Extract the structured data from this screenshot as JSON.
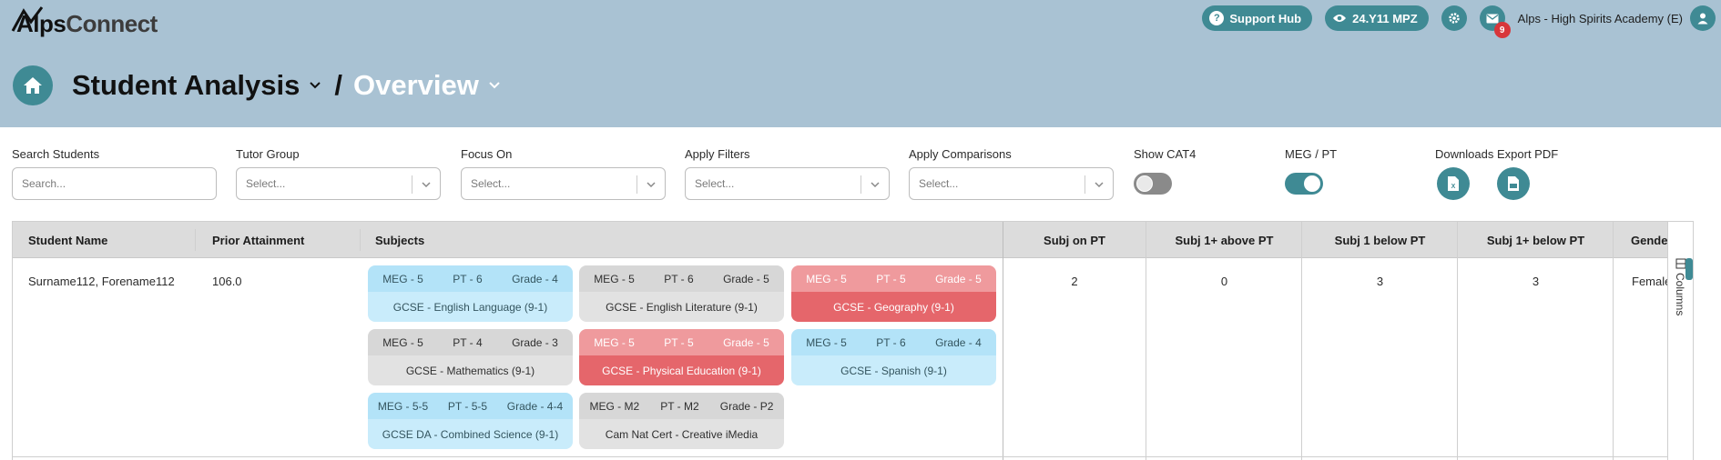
{
  "logo": {
    "alps": "Alps",
    "connect": "Connect"
  },
  "topbar": {
    "support_hub": "Support Hub",
    "data_pill": "24.Y11 MPZ",
    "notification_count": "9",
    "account_name": "Alps - High Spirits Academy (E)"
  },
  "page": {
    "title": "Student Analysis",
    "separator": "/",
    "subtitle": "Overview"
  },
  "filters": {
    "search": {
      "label": "Search Students",
      "placeholder": "Search..."
    },
    "tutor_group": {
      "label": "Tutor Group",
      "value": "Select..."
    },
    "focus_on": {
      "label": "Focus On",
      "value": "Select..."
    },
    "apply_filters": {
      "label": "Apply Filters",
      "value": "Select..."
    },
    "apply_comparisons": {
      "label": "Apply Comparisons",
      "value": "Select..."
    },
    "show_cat4": {
      "label": "Show CAT4",
      "state": "off"
    },
    "meg_pt": {
      "label": "MEG / PT",
      "state": "on"
    },
    "downloads": {
      "label": "Downloads"
    },
    "export_pdf": {
      "label": "Export PDF"
    }
  },
  "table": {
    "headers": {
      "student_name": "Student Name",
      "prior_attainment": "Prior Attainment",
      "subjects": "Subjects",
      "subj_on_pt": "Subj on PT",
      "subj_above_pt": "Subj 1+ above PT",
      "subj_1_below_pt": "Subj 1 below PT",
      "subj_below_pt": "Subj 1+ below PT",
      "gender": "Gender"
    },
    "rows": [
      {
        "student_name": "Surname112, Forename112",
        "prior_attainment": "106.0",
        "subj_on_pt": "2",
        "subj_above_pt": "0",
        "subj_1_below_pt": "3",
        "subj_below_pt": "3",
        "gender": "Female",
        "subjects": [
          {
            "meg": "MEG - 5",
            "pt": "PT - 6",
            "grade": "Grade - 4",
            "name": "GCSE - English Language (9-1)",
            "color": "blue"
          },
          {
            "meg": "MEG - 5",
            "pt": "PT - 6",
            "grade": "Grade - 5",
            "name": "GCSE - English Literature (9-1)",
            "color": "grey"
          },
          {
            "meg": "MEG - 5",
            "pt": "PT - 5",
            "grade": "Grade - 5",
            "name": "GCSE - Geography (9-1)",
            "color": "red"
          },
          {
            "meg": "MEG - 5",
            "pt": "PT - 4",
            "grade": "Grade - 3",
            "name": "GCSE - Mathematics (9-1)",
            "color": "grey"
          },
          {
            "meg": "MEG - 5",
            "pt": "PT - 5",
            "grade": "Grade - 5",
            "name": "GCSE - Physical Education (9-1)",
            "color": "red"
          },
          {
            "meg": "MEG - 5",
            "pt": "PT - 6",
            "grade": "Grade - 4",
            "name": "GCSE - Spanish (9-1)",
            "color": "blue"
          },
          {
            "meg": "MEG - 5-5",
            "pt": "PT - 5-5",
            "grade": "Grade - 4-4",
            "name": "GCSE DA - Combined Science (9-1)",
            "color": "blue"
          },
          {
            "meg": "MEG - M2",
            "pt": "PT - M2",
            "grade": "Grade - P2",
            "name": "Cam Nat Cert - Creative iMedia",
            "color": "grey"
          }
        ]
      }
    ]
  },
  "side_panel": {
    "columns_label": "Columns"
  },
  "colors": {
    "header_bg": "#a9c2d3",
    "accent": "#3f8a94",
    "badge": "#d8363a",
    "card_blue": "#c9ecfb",
    "card_grey": "#e2e2e2",
    "card_red": "#e5666b"
  },
  "icons": {
    "support": "question-icon",
    "data": "eye-icon",
    "settings": "gear-icon",
    "mail": "envelope-icon",
    "user": "user-icon",
    "home": "home-icon",
    "excel": "excel-file-icon",
    "pdf": "pdf-file-icon",
    "columns": "columns-icon"
  }
}
